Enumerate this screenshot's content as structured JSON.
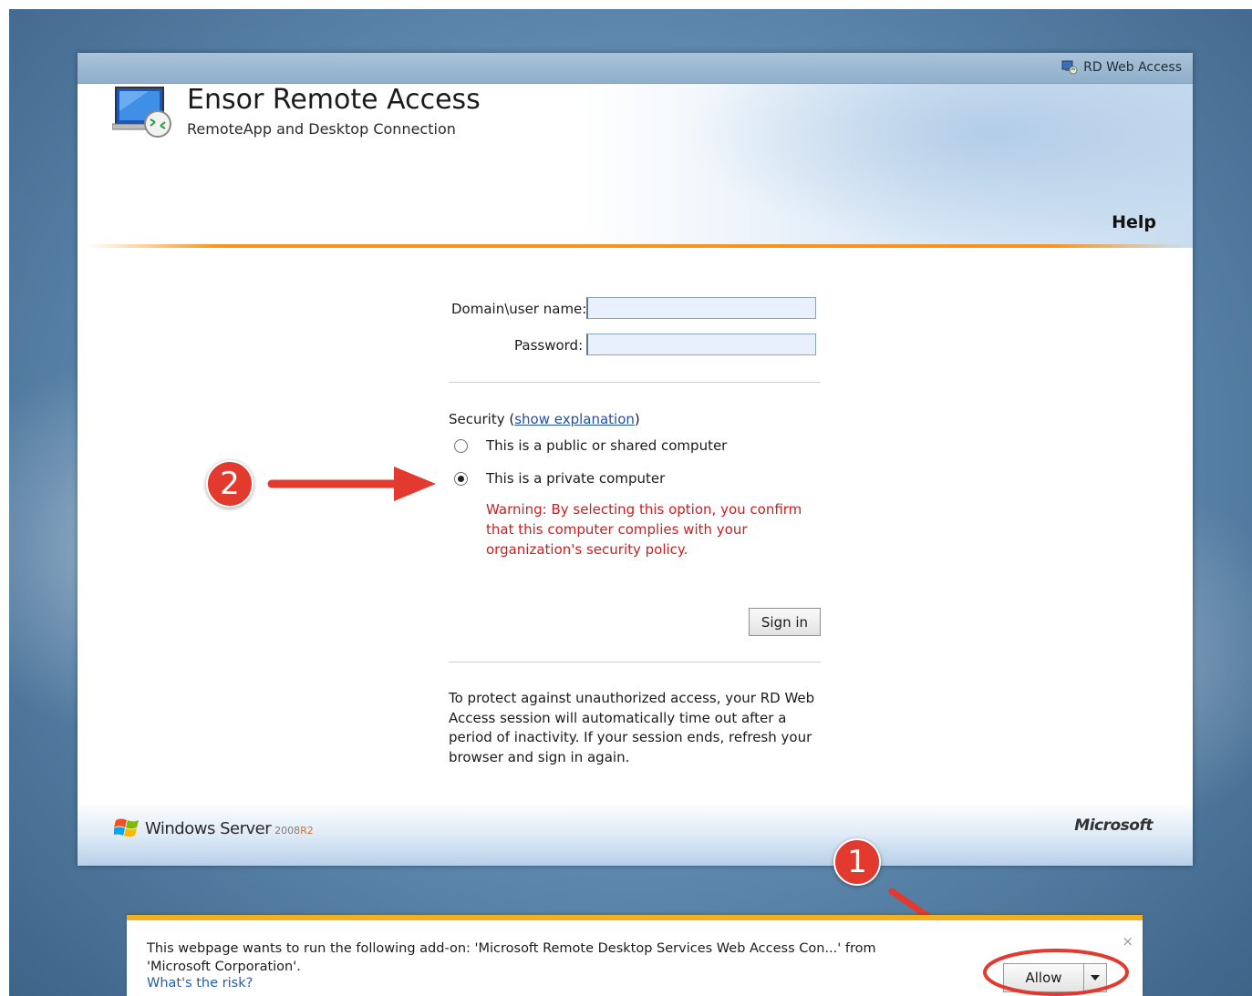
{
  "header_bar": {
    "link": "RD Web Access"
  },
  "app": {
    "title": "Ensor Remote Access",
    "subtitle": "RemoteApp and Desktop Connection",
    "help": "Help"
  },
  "form": {
    "username_label": "Domain\\user name:",
    "username_value": "",
    "password_label": "Password:",
    "password_value": "",
    "security_label": "Security (",
    "security_link": "show explanation",
    "security_close": ")",
    "public_option": "This is a public or shared computer",
    "private_option": "This is a private computer",
    "selected_option": "private",
    "warning": "Warning: By selecting this option, you confirm that this computer complies with your organization's security policy.",
    "signin": "Sign in",
    "timeout_note": "To protect against unauthorized access, your RD Web Access session will automatically time out after a period of inactivity. If your session ends, refresh your browser and sign in again."
  },
  "footer": {
    "windows_text": "Windows Server",
    "windows_version": "2008",
    "windows_release": "R2",
    "microsoft": "Microsoft"
  },
  "annotations": {
    "badge_1": "1",
    "badge_2": "2"
  },
  "infobar": {
    "message": "This webpage wants to run the following add-on: 'Microsoft Remote Desktop Services Web Access Con...' from 'Microsoft Corporation'.",
    "risk_link": "What's the risk?",
    "allow": "Allow",
    "close": "×"
  },
  "colors": {
    "accent_orange": "#f7941e",
    "annotation_red": "#e23a2e",
    "warning_red": "#cc1f1f",
    "link_blue": "#1f4fb3",
    "infobar_yellow": "#f2b01c"
  }
}
